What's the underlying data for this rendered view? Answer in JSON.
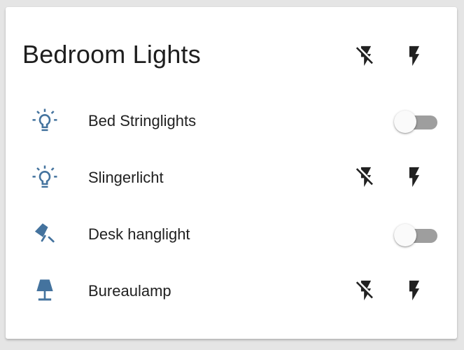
{
  "card": {
    "title": "Bedroom Lights",
    "header_actions": [
      {
        "icon": "flash-off-icon"
      },
      {
        "icon": "flash-icon"
      }
    ]
  },
  "entities": [
    {
      "name": "Bed Stringlights",
      "icon": "lightbulb-outline-icon",
      "control": "toggle",
      "state": "off"
    },
    {
      "name": "Slingerlicht",
      "icon": "lightbulb-outline-icon",
      "control": "buttons",
      "buttons": [
        "flash-off-icon",
        "flash-icon"
      ]
    },
    {
      "name": "Desk hanglight",
      "icon": "desk-lamp-icon",
      "control": "toggle",
      "state": "off"
    },
    {
      "name": "Bureaulamp",
      "icon": "lamp-icon",
      "control": "buttons",
      "buttons": [
        "flash-off-icon",
        "flash-icon"
      ]
    }
  ],
  "colors": {
    "background": "#e5e5e5",
    "card": "#ffffff",
    "entity_icon": "#44739e",
    "action_icon": "#212121",
    "toggle_track_off": "#9e9e9e",
    "toggle_thumb_off": "#fafafa"
  }
}
